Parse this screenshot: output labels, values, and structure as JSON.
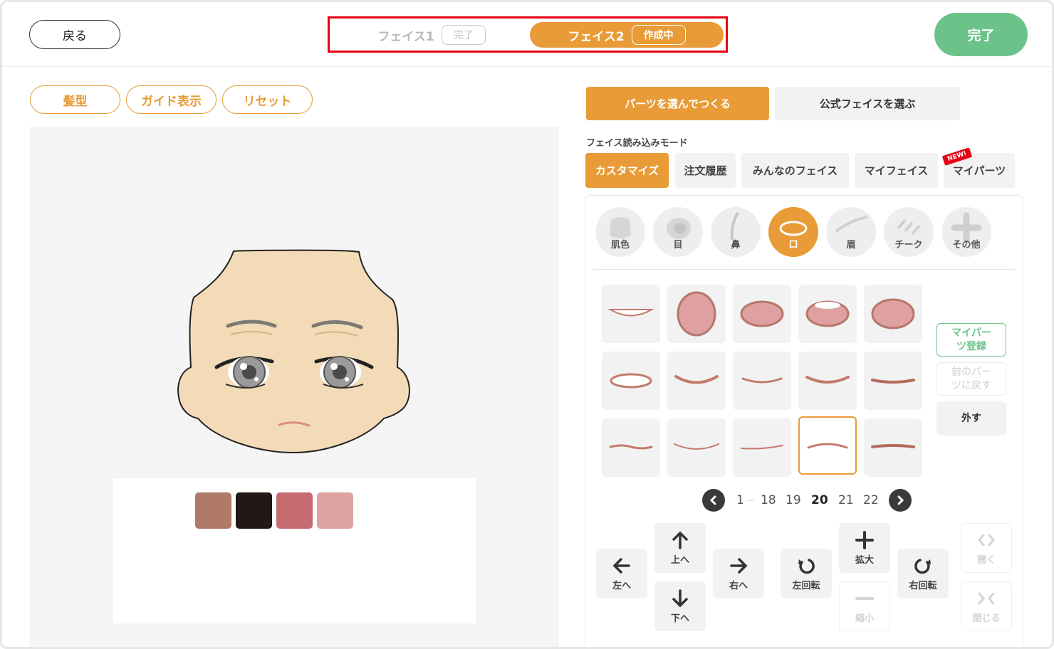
{
  "header": {
    "back_label": "戻る",
    "face1": {
      "label": "フェイス1",
      "status": "完了"
    },
    "face2": {
      "label": "フェイス2",
      "status": "作成中"
    },
    "done_label": "完了"
  },
  "tools": {
    "hair": "髪型",
    "guide": "ガイド表示",
    "reset": "リセット"
  },
  "palette": {
    "colors": [
      "#b07a68",
      "#231815",
      "#c66b70",
      "#dea2a2"
    ]
  },
  "mode_tabs": {
    "parts": "パーツを選んでつくる",
    "official": "公式フェイスを選ぶ"
  },
  "load_mode_caption": "フェイス読み込みモード",
  "sub_tabs": {
    "customize": "カスタマイズ",
    "history": "注文履歴",
    "everyone": "みんなのフェイス",
    "my_face": "マイフェイス",
    "my_parts": "マイパーツ",
    "new_badge": "NEW!"
  },
  "categories": [
    {
      "label": "肌色",
      "icon": "skin-icon"
    },
    {
      "label": "目",
      "icon": "eye-icon"
    },
    {
      "label": "鼻",
      "icon": "nose-icon"
    },
    {
      "label": "口",
      "icon": "mouth-icon"
    },
    {
      "label": "眉",
      "icon": "eyebrow-icon"
    },
    {
      "label": "チーク",
      "icon": "cheek-icon"
    },
    {
      "label": "その他",
      "icon": "plus-icon"
    }
  ],
  "selected_category": "口",
  "side_buttons": {
    "register": "マイパーツ登録",
    "previous": "前のパーツに戻す",
    "remove": "外す"
  },
  "pagination": {
    "first": "1",
    "ellipsis": "...",
    "pages": [
      "18",
      "19",
      "20",
      "21",
      "22"
    ],
    "current": "20"
  },
  "controls": {
    "left": "左へ",
    "up": "上へ",
    "down": "下へ",
    "right": "右へ",
    "rotate_left": "左回転",
    "enlarge": "拡大",
    "shrink": "縮小",
    "rotate_right": "右回転",
    "open": "開く",
    "close": "閉じる"
  },
  "colors": {
    "accent": "#e89b36",
    "done_green": "#6cc38a",
    "skin": "#f2dbb6",
    "lip": "#c47a6a"
  }
}
